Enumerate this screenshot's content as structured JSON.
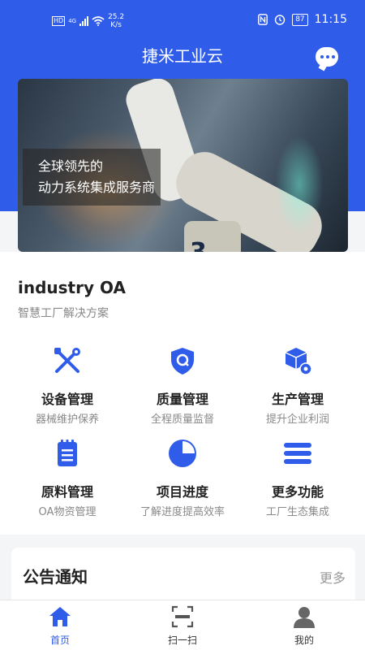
{
  "status_bar": {
    "hd": "HD",
    "network": "4G",
    "speed_value": "25.2",
    "speed_unit": "K/s",
    "battery": "87",
    "time": "11:15"
  },
  "header": {
    "title": "捷米工业云",
    "message_icon": "chat-bubble-icon"
  },
  "banner": {
    "line1": "全球领先的",
    "line2": "动力系统集成服务商",
    "robot_number": "3"
  },
  "section": {
    "title": "industry OA",
    "subtitle": "智慧工厂解决方案"
  },
  "features": [
    {
      "name": "设备管理",
      "desc": "器械维护保养",
      "icon": "tools-icon"
    },
    {
      "name": "质量管理",
      "desc": "全程质量监督",
      "icon": "shield-q-icon"
    },
    {
      "name": "生产管理",
      "desc": "提升企业利润",
      "icon": "box-gear-icon"
    },
    {
      "name": "原料管理",
      "desc": "OA物资管理",
      "icon": "notepad-icon"
    },
    {
      "name": "项目进度",
      "desc": "了解进度提高效率",
      "icon": "pie-chart-icon"
    },
    {
      "name": "更多功能",
      "desc": "工厂生态集成",
      "icon": "menu-lines-icon"
    }
  ],
  "notice": {
    "title": "公告通知",
    "more": "更多"
  },
  "tabs": [
    {
      "label": "首页",
      "icon": "home-icon",
      "active": true
    },
    {
      "label": "扫一扫",
      "icon": "scan-icon",
      "active": false
    },
    {
      "label": "我的",
      "icon": "user-icon",
      "active": false
    }
  ],
  "colors": {
    "primary": "#2f5ce8",
    "tab_inactive": "#333333"
  }
}
